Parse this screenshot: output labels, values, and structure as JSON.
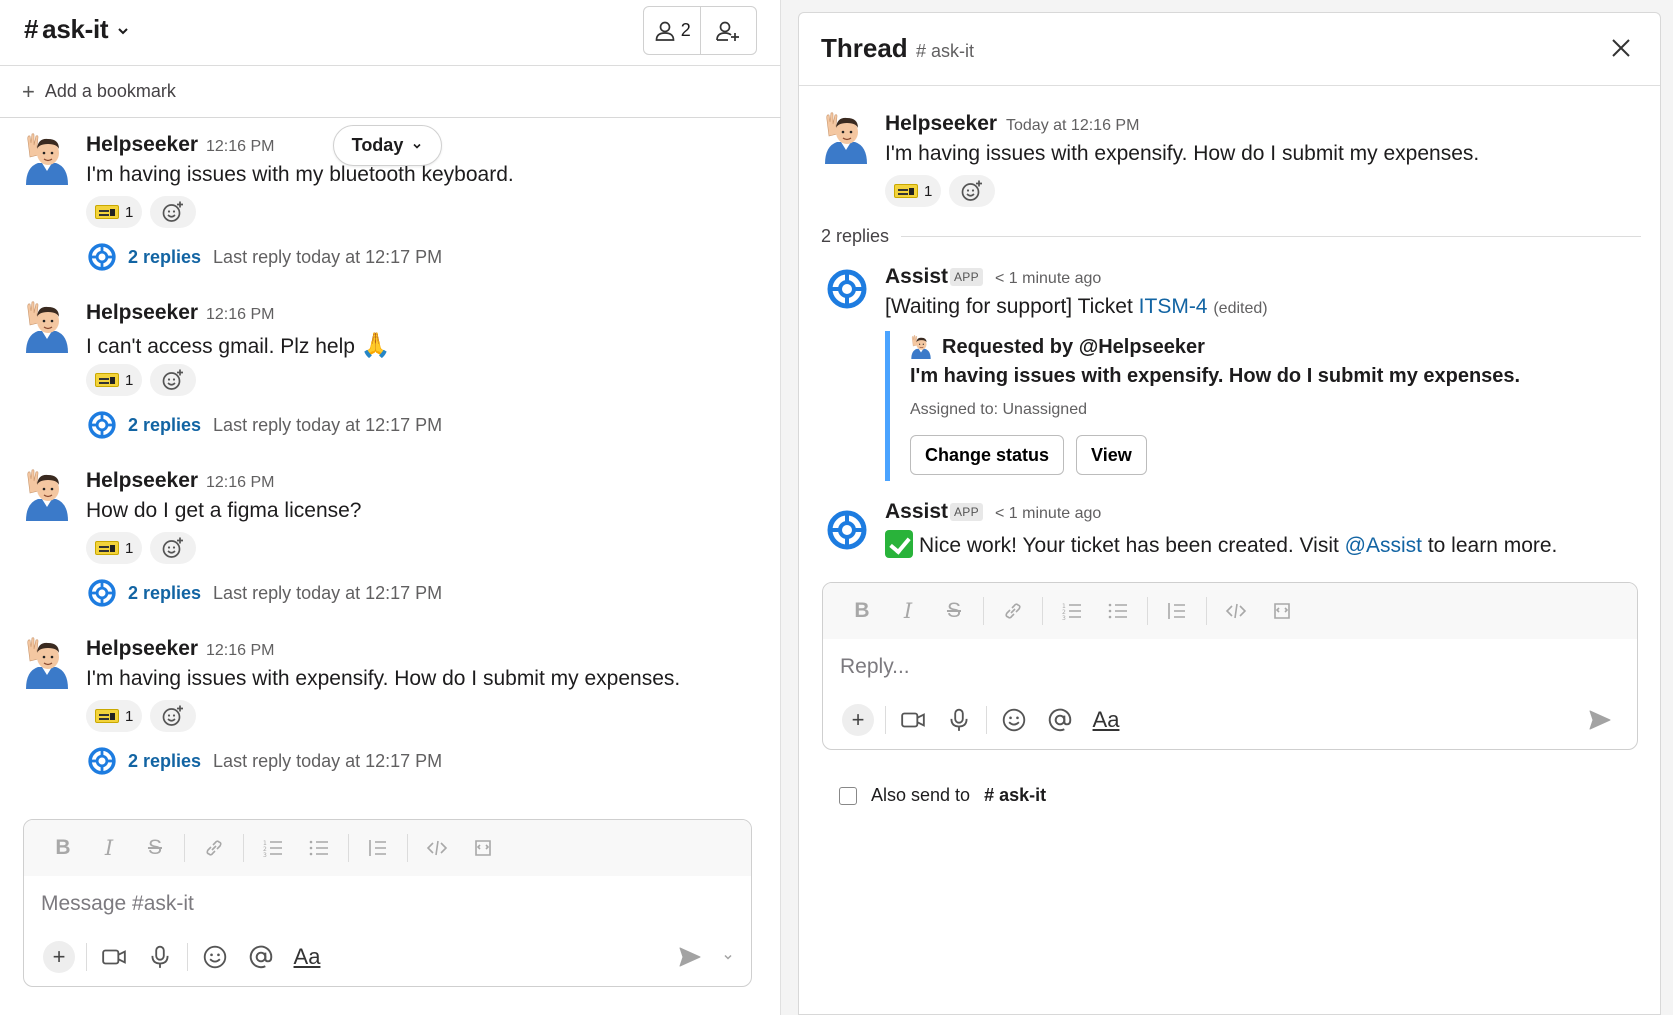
{
  "channel": {
    "name": "ask-it",
    "member_count": "2",
    "bookmark_label": "Add a bookmark",
    "today_label": "Today"
  },
  "messages": [
    {
      "author": "Helpseeker",
      "time": "12:16 PM",
      "text": "I'm having issues with my bluetooth keyboard.",
      "reaction_count": "1",
      "replies": "2 replies",
      "last_reply": "Last reply today at 12:17 PM"
    },
    {
      "author": "Helpseeker",
      "time": "12:16 PM",
      "text": "I can't access gmail. Plz help",
      "reaction_count": "1",
      "replies": "2 replies",
      "last_reply": "Last reply today at 12:17 PM"
    },
    {
      "author": "Helpseeker",
      "time": "12:16 PM",
      "text": "How do I get a figma license?",
      "reaction_count": "1",
      "replies": "2 replies",
      "last_reply": "Last reply today at 12:17 PM"
    },
    {
      "author": "Helpseeker",
      "time": "12:16 PM",
      "text": "I'm having issues with expensify. How do I submit my expenses.",
      "reaction_count": "1",
      "replies": "2 replies",
      "last_reply": "Last reply today at 12:17 PM"
    }
  ],
  "composer": {
    "placeholder": "Message #ask-it"
  },
  "thread": {
    "title": "Thread",
    "channel": "# ask-it",
    "parent": {
      "author": "Helpseeker",
      "time": "Today at 12:16 PM",
      "text": "I'm having issues with expensify. How do I submit my expenses.",
      "reaction_count": "1"
    },
    "replies_label": "2 replies",
    "reply1": {
      "author": "Assist",
      "badge": "APP",
      "time": "< 1 minute ago",
      "text_prefix": "[Waiting for support] Ticket ",
      "ticket_link": "ITSM-4",
      "edited": "(edited)",
      "attachment": {
        "requested_by": "Requested by @Helpseeker",
        "title": "I'm having issues with expensify. How do I submit my expenses.",
        "assigned": "Assigned to: Unassigned",
        "change_status_label": "Change status",
        "view_label": "View"
      }
    },
    "reply2": {
      "author": "Assist",
      "badge": "APP",
      "time": "< 1 minute ago",
      "text_prefix": "Nice work! Your ticket has been created. Visit ",
      "mention": "@Assist",
      "text_suffix": " to learn more."
    },
    "composer_placeholder": "Reply...",
    "also_send_label": "Also send to",
    "also_send_channel": "ask-it"
  },
  "colors": {
    "link": "#1264a3",
    "accent_bar": "#4aa3ff",
    "assist_blue": "#1d7ce0"
  }
}
